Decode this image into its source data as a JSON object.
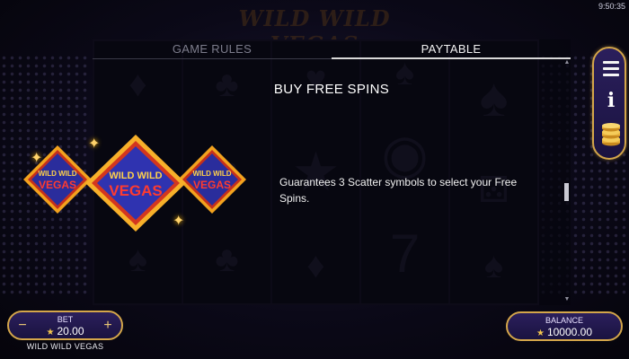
{
  "status_bar": {
    "time": "9:50:35"
  },
  "game": {
    "title": "WILD WILD VEGAS"
  },
  "tabs": [
    {
      "label": "GAME RULES",
      "active": false
    },
    {
      "label": "PAYTABLE",
      "active": true
    }
  ],
  "panel": {
    "title": "BUY FREE SPINS",
    "description": "Guarantees 3 Scatter symbols to select your Free Spins."
  },
  "badges": [
    {
      "line1": "WILD WILD",
      "line2": "VEGAS"
    },
    {
      "line1": "WILD WILD",
      "line2": "VEGAS"
    },
    {
      "line1": "WILD WILD",
      "line2": "VEGAS"
    }
  ],
  "side_menu": {
    "items": [
      {
        "icon": "hamburger-menu-icon"
      },
      {
        "icon": "info-icon",
        "glyph": "i"
      },
      {
        "icon": "coins-icon"
      }
    ]
  },
  "bet": {
    "label": "BET",
    "value": "20.00",
    "minus": "−",
    "plus": "+"
  },
  "balance": {
    "label": "BALANCE",
    "value": "10000.00"
  },
  "colors": {
    "accent_gold": "#d4a64a",
    "panel_purple": "#2b1f5c",
    "badge_blue": "#2a2d9c",
    "badge_red": "#e0302a"
  }
}
